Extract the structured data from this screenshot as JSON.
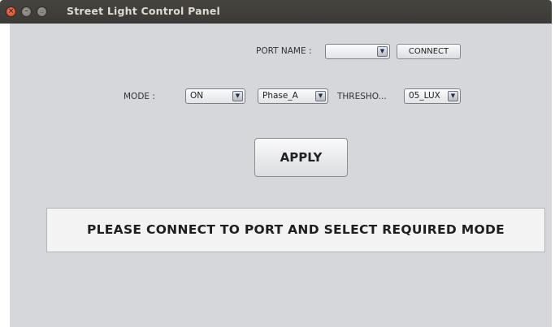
{
  "window": {
    "title": "Street Light Control Panel",
    "controls": {
      "close": "×",
      "minimize": "–",
      "maximize": "▫"
    }
  },
  "port": {
    "label": "PORT NAME :",
    "selected": "",
    "connect_label": "CONNECT"
  },
  "mode": {
    "label": "MODE :",
    "selected": "ON",
    "phase_selected": "Phase_A",
    "threshold_label": "THRESHO...",
    "threshold_selected": "05_LUX"
  },
  "apply_label": "APPLY",
  "status_message": "PLEASE CONNECT TO PORT  AND SELECT REQUIRED MODE",
  "icons": {
    "dropdown_arrow": "▼"
  },
  "colors": {
    "titlebar": "#3f3e3a",
    "panel": "#d6d7db",
    "close_button": "#e4532f"
  }
}
